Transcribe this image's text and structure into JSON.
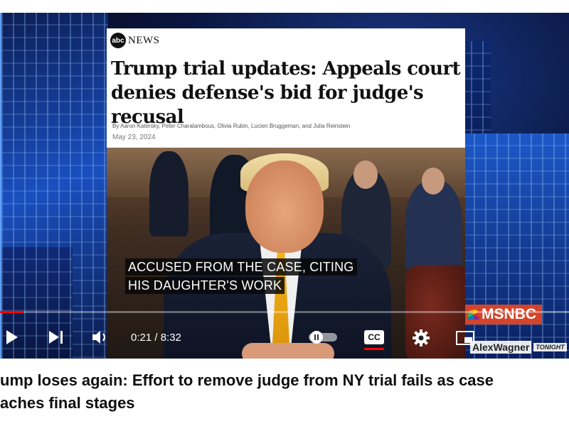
{
  "article": {
    "logo": "abc",
    "outlet": "NEWS",
    "headline": "Trump trial updates: Appeals court denies defense's bid for judge's recusal",
    "bylines": "By Aaron Katersky, Peter Charalambous, Olivia Rubin, Lucien Bruggeman, and Julia Reinstein",
    "date": "May 23, 2024"
  },
  "captions": {
    "line1": "ACCUSED FROM THE CASE,  CITING",
    "line2": "HIS DAUGHTER'S WORK"
  },
  "network": {
    "logo_text": "MSNBC",
    "show_name": "AlexWagner",
    "show_suffix": "TONIGHT"
  },
  "player": {
    "time_display": "0:21 / 8:32",
    "progress_fraction": 0.041,
    "cc_label": "CC",
    "accent_color": "#ff0000",
    "icons": {
      "play": "play-icon",
      "next": "next-icon",
      "volume": "volume-icon",
      "autoplay": "autoplay-toggle-icon",
      "cc": "captions-icon",
      "settings": "gear-icon",
      "miniplayer": "miniplayer-icon"
    }
  },
  "video": {
    "title_line1": "ump loses again: Effort to remove judge from NY trial fails as case",
    "title_line2": "aches final stages"
  }
}
